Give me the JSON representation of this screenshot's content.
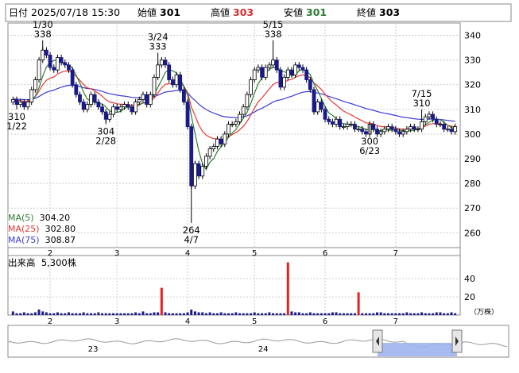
{
  "header": {
    "date_label": "日付",
    "datetime": "2025/07/18 15:30",
    "open_label": "始値",
    "open": "301",
    "high_label": "高値",
    "high": "303",
    "low_label": "安値",
    "low": "301",
    "close_label": "終値",
    "close": "303"
  },
  "ma": [
    {
      "label": "MA(5)",
      "value": "304.20",
      "color": "#2e7d32"
    },
    {
      "label": "MA(25)",
      "value": "302.80",
      "color": "#e53935"
    },
    {
      "label": "MA(75)",
      "value": "308.87",
      "color": "#3b3bd6"
    }
  ],
  "volume_header": {
    "label": "出来高",
    "value": "5,300株"
  },
  "volume_unit": "（万株）",
  "colors": {
    "up": "#ffffff",
    "down": "#1a1a8c",
    "vol": "#1a1a8c",
    "vol_spike": "#e82020",
    "nav_fill": "#9db4f0"
  },
  "chart_data": {
    "type": "candlestick",
    "price_axis": {
      "ticks": [
        260,
        270,
        280,
        290,
        300,
        310,
        320,
        330,
        340
      ],
      "ylim": [
        254,
        345
      ]
    },
    "volume_axis": {
      "ticks": [
        20,
        40
      ],
      "ylim": [
        0,
        55
      ]
    },
    "month_ticks": [
      {
        "label": "2",
        "index": 10
      },
      {
        "label": "3",
        "index": 28
      },
      {
        "label": "4",
        "index": 47
      },
      {
        "label": "5",
        "index": 65
      },
      {
        "label": "6",
        "index": 84
      },
      {
        "label": "7",
        "index": 103
      }
    ],
    "navigator_labels": [
      {
        "label": "23",
        "pos": 0.17
      },
      {
        "label": "24",
        "pos": 0.51
      }
    ],
    "annotations": [
      {
        "index": 8,
        "price": 338,
        "date": "1/30",
        "value": "338",
        "pos": "above"
      },
      {
        "index": 39,
        "price": 333,
        "date": "3/24",
        "value": "333",
        "pos": "above"
      },
      {
        "index": 70,
        "price": 338,
        "date": "5/15",
        "value": "338",
        "pos": "above"
      },
      {
        "index": 110,
        "price": 310,
        "date": "7/15",
        "value": "310",
        "pos": "above"
      },
      {
        "index": 1,
        "price": 310,
        "date": "1/22",
        "value": "310",
        "pos": "below"
      },
      {
        "index": 25,
        "price": 304,
        "date": "2/28",
        "value": "304",
        "pos": "below"
      },
      {
        "index": 48,
        "price": 264,
        "date": "4/7",
        "value": "264",
        "pos": "below"
      },
      {
        "index": 96,
        "price": 300,
        "date": "6/23",
        "value": "300",
        "pos": "below"
      }
    ],
    "close": [
      314,
      312,
      313,
      311,
      313,
      318,
      322,
      330,
      334,
      332,
      327,
      326,
      331,
      329,
      328,
      326,
      320,
      316,
      313,
      310,
      312,
      316,
      313,
      311,
      309,
      306,
      308,
      311,
      310,
      311,
      312,
      311,
      309,
      313,
      314,
      316,
      312,
      316,
      323,
      328,
      330,
      328,
      322,
      320,
      324,
      318,
      313,
      303,
      279,
      288,
      283,
      287,
      291,
      294,
      295,
      298,
      296,
      300,
      304,
      304,
      305,
      308,
      311,
      316,
      322,
      326,
      327,
      323,
      327,
      328,
      330,
      326,
      319,
      323,
      326,
      324,
      328,
      327,
      326,
      322,
      318,
      309,
      313,
      310,
      306,
      305,
      304,
      306,
      303,
      303,
      304,
      304,
      302,
      302,
      301,
      300,
      304,
      302,
      300,
      301,
      302,
      303,
      302,
      301,
      300,
      301,
      302,
      303,
      302,
      302,
      305,
      307,
      308,
      306,
      304,
      304,
      302,
      302,
      301,
      303
    ],
    "volume": [
      4,
      2,
      2,
      3,
      2,
      2,
      3,
      6,
      4,
      3,
      2,
      2,
      3,
      2,
      2,
      3,
      2,
      2,
      2,
      3,
      2,
      2,
      2,
      3,
      2,
      2,
      2,
      2,
      2,
      2,
      2,
      2,
      2,
      3,
      2,
      4,
      2,
      2,
      3,
      3,
      30,
      3,
      2,
      2,
      2,
      2,
      2,
      3,
      6,
      4,
      3,
      3,
      2,
      3,
      2,
      2,
      3,
      2,
      2,
      2,
      3,
      2,
      2,
      2,
      2,
      3,
      2,
      2,
      2,
      3,
      2,
      2,
      2,
      2,
      58,
      4,
      3,
      3,
      2,
      2,
      3,
      2,
      2,
      2,
      2,
      2,
      3,
      3,
      2,
      2,
      2,
      2,
      2,
      25,
      2,
      2,
      2,
      2,
      3,
      3,
      2,
      2,
      2,
      2,
      2,
      2,
      3,
      2,
      2,
      2,
      3,
      2,
      2,
      2,
      3,
      3,
      2,
      2,
      3,
      2
    ],
    "volume_spike_indices": [
      40,
      74,
      93
    ],
    "ma_values": {
      "ma5": 304.2,
      "ma25": 302.8,
      "ma75": 308.87
    }
  }
}
